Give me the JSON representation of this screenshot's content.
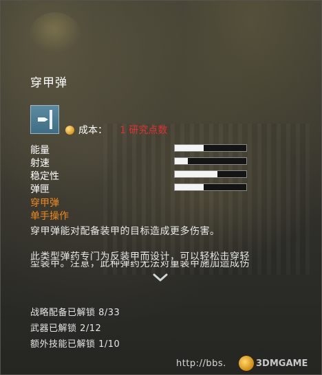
{
  "item": {
    "name": "穿甲弹",
    "icon": "bullet-icon",
    "cost_label": "成本：",
    "cost_value": "1 研究点数"
  },
  "stats": [
    {
      "name": "能量",
      "value": 0.4
    },
    {
      "name": "射速",
      "value": 0.18
    },
    {
      "name": "稳定性",
      "value": 0.6
    },
    {
      "name": "弹匣",
      "value": 0.4
    }
  ],
  "tags": [
    "穿甲弹",
    "单手操作"
  ],
  "description": {
    "line1": "穿甲弹能对配备装甲的目标造成更多伤害。",
    "line2": "此类型弹药专门为反装甲而设计，可以轻松击穿轻",
    "line3_partial": "型装甲。注意，此种弹药无法对重装甲施加造成伤"
  },
  "unlocks": {
    "tactical": "战略配备已解锁 8/33",
    "weapons": "武器已解锁 2/12",
    "skills": "额外技能已解锁 1/10"
  },
  "watermark": {
    "url": "http://bbs.",
    "brand": "3DMGAME"
  },
  "colors": {
    "cost_value": "#e23030",
    "tag": "#f08a1a",
    "bar_fill": "#f4f4f4"
  }
}
